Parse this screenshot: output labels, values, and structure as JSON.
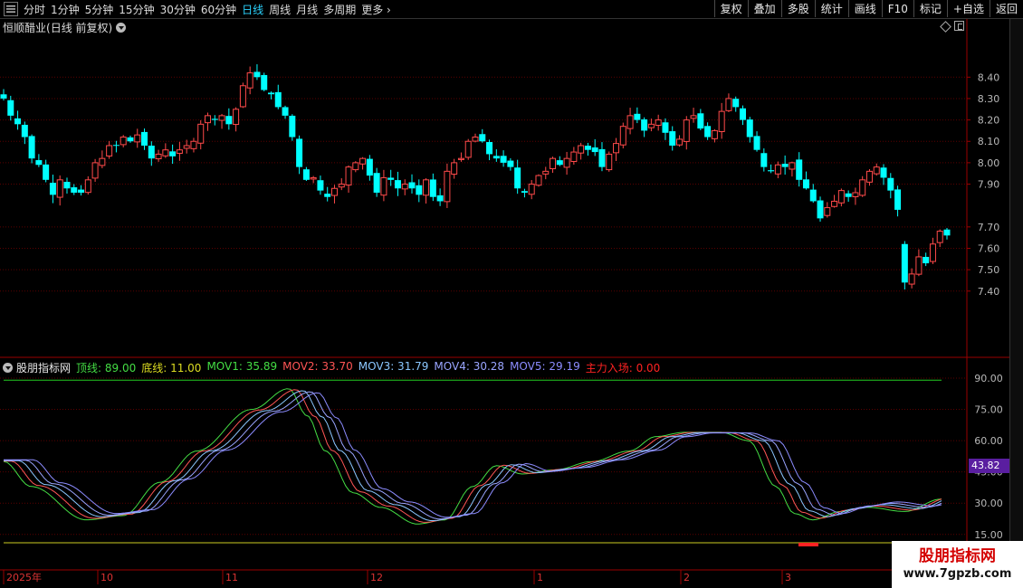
{
  "toolbar": {
    "periods": [
      "分时",
      "1分钟",
      "5分钟",
      "15分钟",
      "30分钟",
      "60分钟",
      "日线",
      "周线",
      "月线",
      "多周期",
      "更多"
    ],
    "active_period": "日线",
    "right_buttons": [
      "复权",
      "叠加",
      "多股",
      "统计",
      "画线",
      "F10",
      "标记",
      "+自选",
      "返回"
    ]
  },
  "stock": {
    "name": "恒顺醋业",
    "mode": "(日线 前复权)"
  },
  "price_axis": {
    "ticks": [
      "8.40",
      "8.30",
      "8.20",
      "8.10",
      "8.00",
      "7.90",
      "7.70",
      "7.60",
      "7.50",
      "7.40"
    ]
  },
  "indicator": {
    "name": "股朋指标网",
    "items": [
      {
        "label": "顶线:",
        "value": "89.00",
        "color": "#44dd44"
      },
      {
        "label": "底线:",
        "value": "11.00",
        "color": "#dddd22"
      },
      {
        "label": "MOV1:",
        "value": "35.89",
        "color": "#44dd44"
      },
      {
        "label": "MOV2:",
        "value": "33.70",
        "color": "#ff5555"
      },
      {
        "label": "MOV3:",
        "value": "31.79",
        "color": "#8bc7ff"
      },
      {
        "label": "MOV4:",
        "value": "30.28",
        "color": "#9aa5ff"
      },
      {
        "label": "MOV5:",
        "value": "29.19",
        "color": "#8c8cff"
      },
      {
        "label": "主力入场:",
        "value": "0.00",
        "color": "#ff2222"
      }
    ],
    "axis_ticks": [
      "90.00",
      "75.00",
      "60.00",
      "45.00",
      "30.00",
      "15.00"
    ],
    "current_tag": "43.82"
  },
  "date_axis": {
    "labels": [
      "2025年",
      "10",
      "11",
      "12",
      "1",
      "2",
      "3"
    ]
  },
  "watermark": {
    "line1": "股朋指标网",
    "line2": "www.7gpzb.com"
  },
  "chart_data": {
    "type": "candlestick",
    "title": "恒顺醋业(日线 前复权)",
    "ylim": [
      7.12,
      8.6
    ],
    "up_color": "#ff4a4a",
    "down_color": "#00ffff",
    "closes": [
      8.3,
      8.22,
      8.18,
      8.12,
      8.02,
      7.99,
      7.92,
      7.85,
      7.92,
      7.88,
      7.86,
      7.86,
      7.92,
      8.0,
      8.02,
      8.08,
      8.08,
      8.12,
      8.1,
      8.13,
      8.08,
      8.02,
      8.04,
      8.06,
      8.03,
      8.06,
      8.08,
      8.1,
      8.18,
      8.22,
      8.2,
      8.22,
      8.18,
      8.25,
      8.36,
      8.42,
      8.4,
      8.34,
      8.32,
      8.26,
      8.22,
      8.12,
      7.98,
      7.92,
      7.93,
      7.87,
      7.84,
      7.88,
      7.9,
      7.98,
      8.0,
      8.02,
      7.94,
      7.86,
      7.93,
      7.92,
      7.88,
      7.9,
      7.88,
      7.85,
      7.92,
      7.84,
      7.82,
      7.96,
      8.0,
      8.02,
      8.1,
      8.12,
      8.1,
      8.04,
      8.02,
      8.0,
      7.98,
      7.88,
      7.86,
      7.9,
      7.94,
      7.96,
      8.02,
      7.99,
      8.02,
      8.05,
      8.08,
      8.06,
      8.05,
      7.98,
      8.04,
      8.09,
      8.17,
      8.22,
      8.2,
      8.15,
      8.18,
      8.2,
      8.14,
      8.08,
      8.11,
      8.2,
      8.22,
      8.16,
      8.12,
      8.15,
      8.24,
      8.3,
      8.26,
      8.2,
      8.12,
      8.06,
      7.98,
      7.96,
      7.99,
      7.98,
      8.0,
      7.92,
      7.88,
      7.82,
      7.74,
      7.79,
      7.82,
      7.87,
      7.84,
      7.86,
      7.92,
      7.96,
      7.98,
      7.93,
      7.87,
      7.78,
      7.44,
      7.48,
      7.56,
      7.53,
      7.62,
      7.68,
      7.66
    ]
  }
}
